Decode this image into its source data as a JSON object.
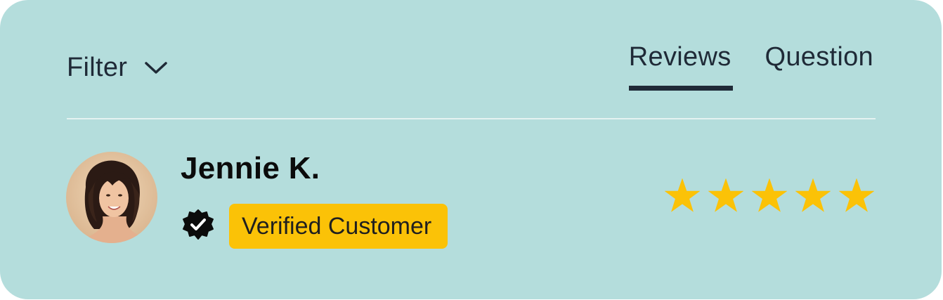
{
  "filter": {
    "label": "Filter",
    "icon": "chevron-down-icon"
  },
  "tabs": [
    {
      "label": "Reviews",
      "active": true
    },
    {
      "label": "Question",
      "active": false
    }
  ],
  "review": {
    "reviewer_name": "Jennie K.",
    "verified_icon": "verified-check-icon",
    "badge_label": "Verified Customer",
    "rating": 5,
    "rating_max": 5
  },
  "colors": {
    "background": "#b4dddc",
    "text": "#1f2a37",
    "badge": "#fbc207",
    "star": "#fbc207"
  }
}
